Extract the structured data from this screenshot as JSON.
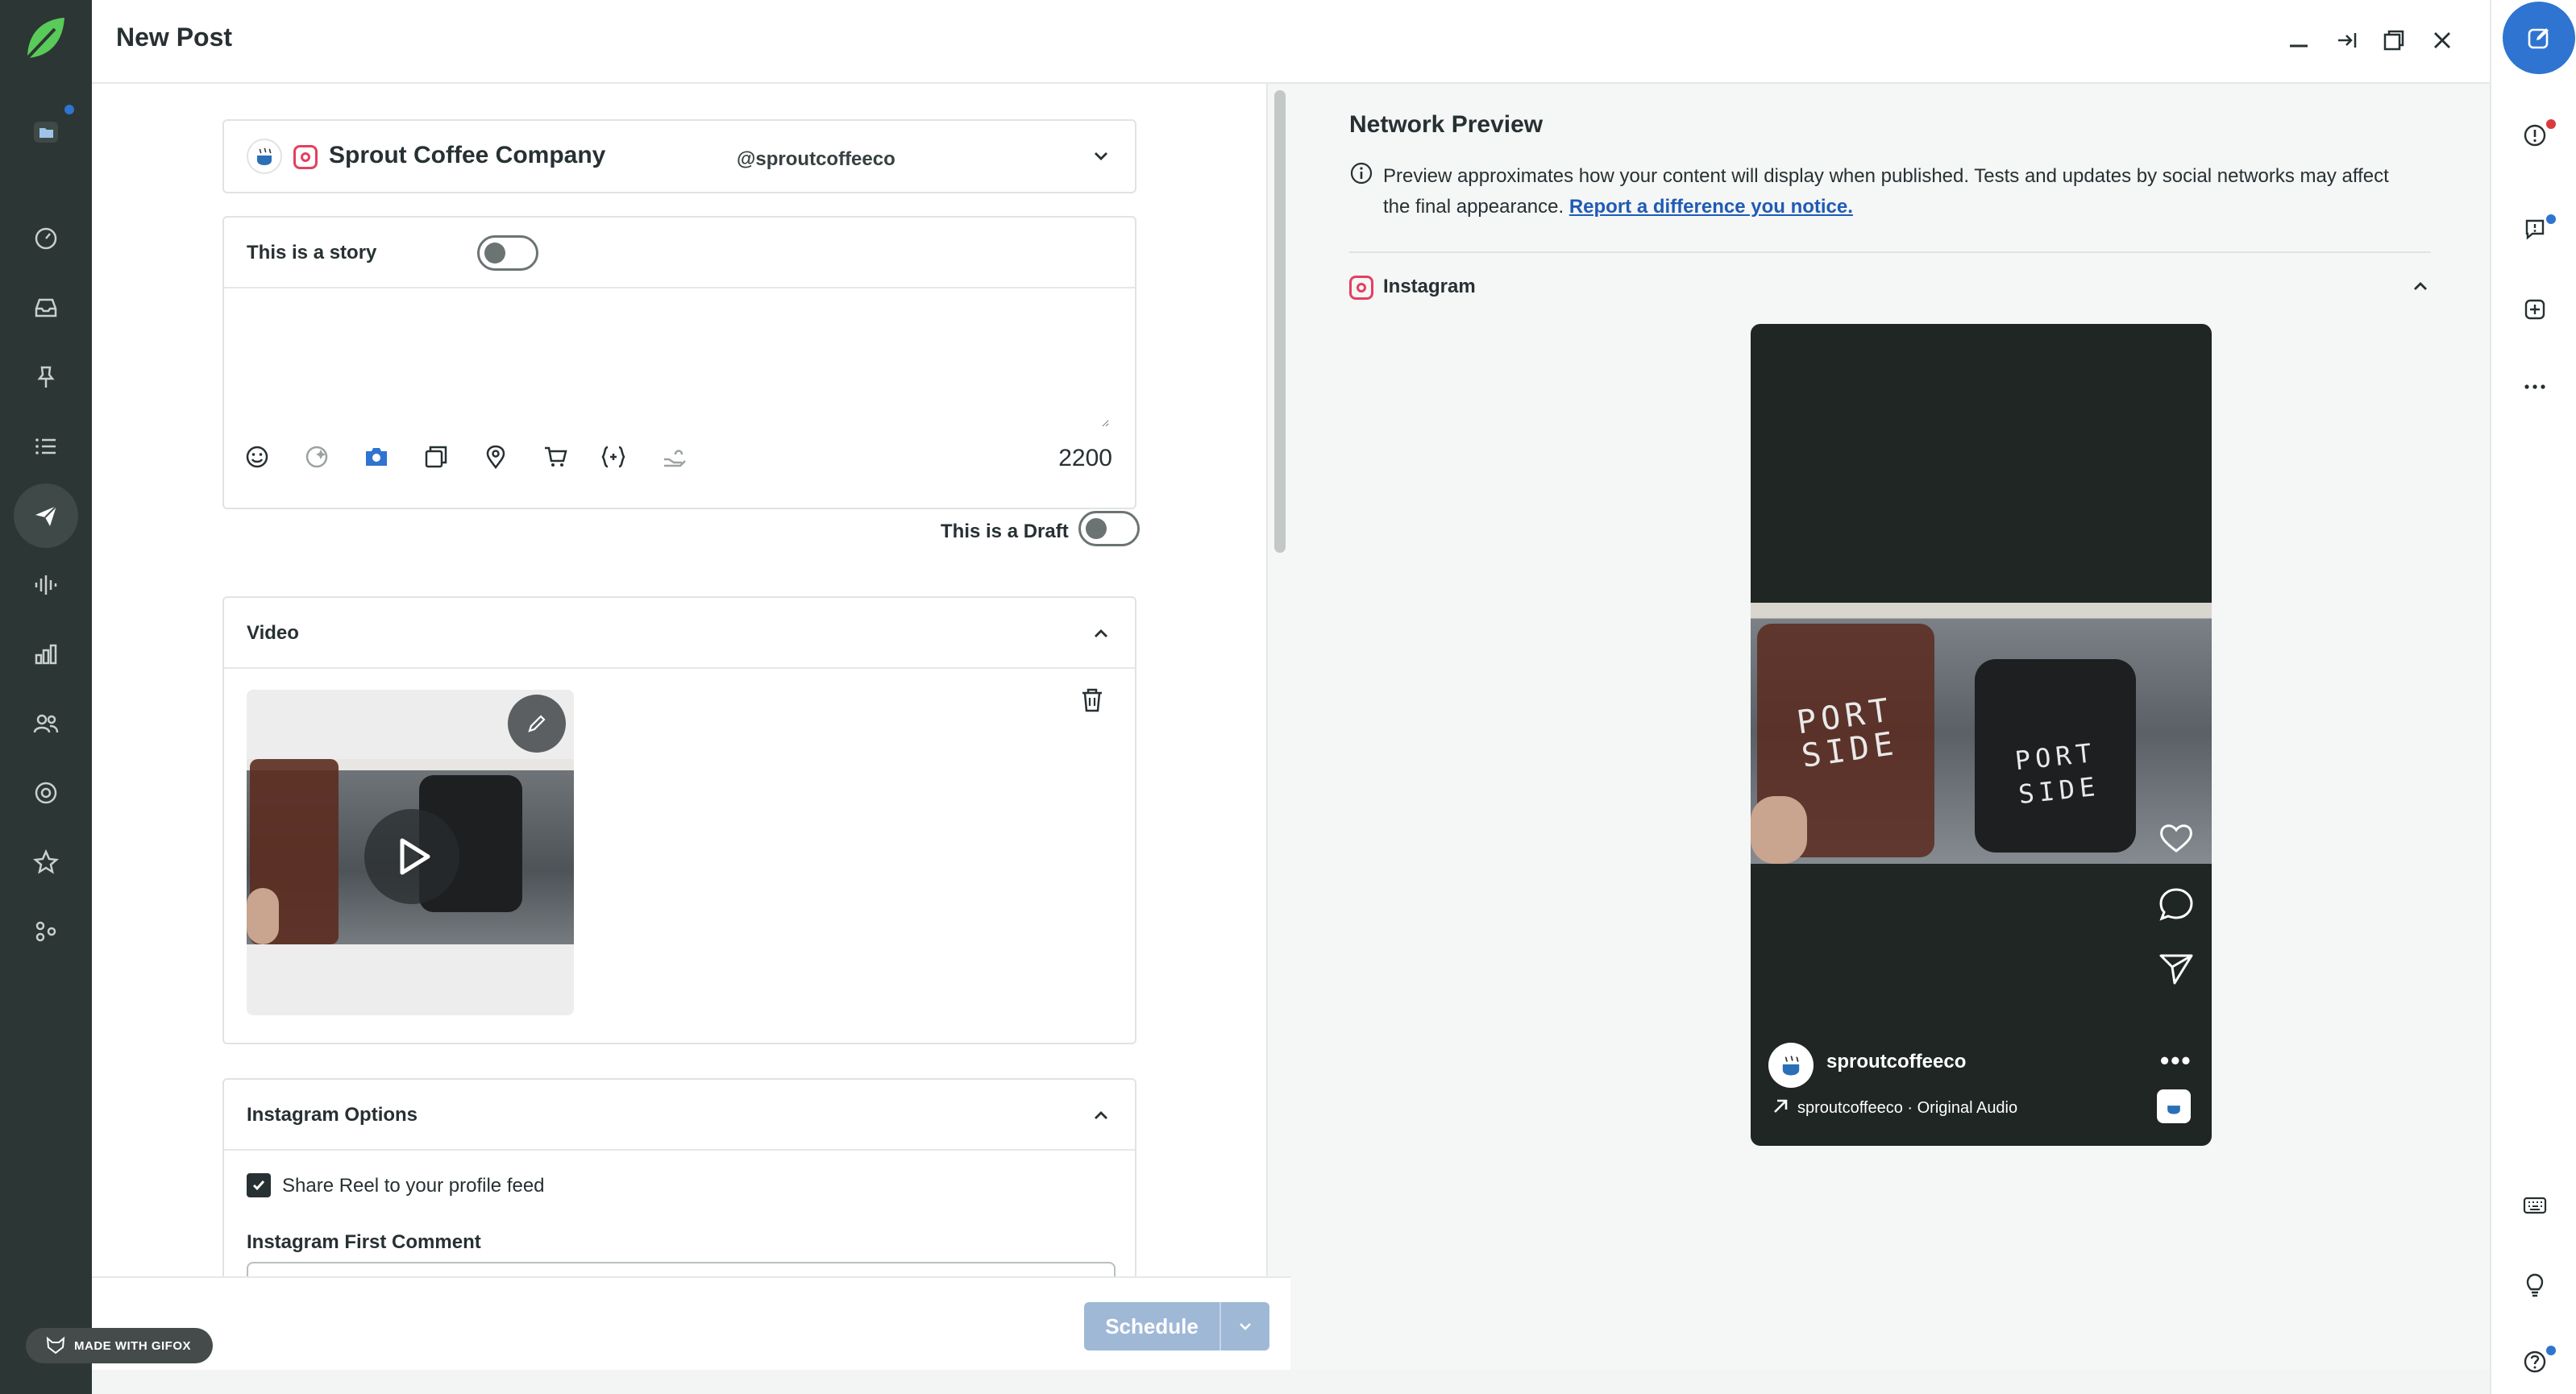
{
  "window": {
    "title": "New Post",
    "controls": [
      "minimize-icon",
      "collapse-icon",
      "popout-icon",
      "close-icon"
    ]
  },
  "profile": {
    "name": "Sprout Coffee Company",
    "handle": "@sproutcoffeeco",
    "network": "instagram-icon"
  },
  "editor": {
    "story_label": "This is a story",
    "story_on": false,
    "message_placeholder": "",
    "char_count": "2200",
    "tools": [
      "emoji-icon",
      "ai-assist-icon",
      "camera-icon",
      "gallery-icon",
      "location-icon",
      "shopping-icon",
      "variables-icon",
      "hand-icon"
    ]
  },
  "draft": {
    "label": "This is a Draft",
    "on": false
  },
  "video_section": {
    "title": "Video"
  },
  "instagram_options": {
    "title": "Instagram Options",
    "share_reel_label": "Share Reel to your profile feed",
    "share_reel_checked": true,
    "first_comment_label": "Instagram First Comment"
  },
  "footer": {
    "schedule_label": "Schedule"
  },
  "preview": {
    "title": "Network Preview",
    "info_text": "Preview approximates how your content will display when published. Tests and updates by social networks may affect the final appearance.",
    "report_link": "Report a difference you notice.",
    "network_label": "Instagram",
    "phone": {
      "account": "sproutcoffeeco",
      "audio": "sproutcoffeeco · Original Audio",
      "more": "•••"
    }
  },
  "gifox": {
    "label": "MADE WITH GIFOX"
  },
  "colors": {
    "nav_bg": "#2c3634",
    "accent": "#2f74d0",
    "instagram": "#e4405f",
    "schedule_disabled": "#9fb8d6",
    "notification_red": "#d93b3b"
  }
}
